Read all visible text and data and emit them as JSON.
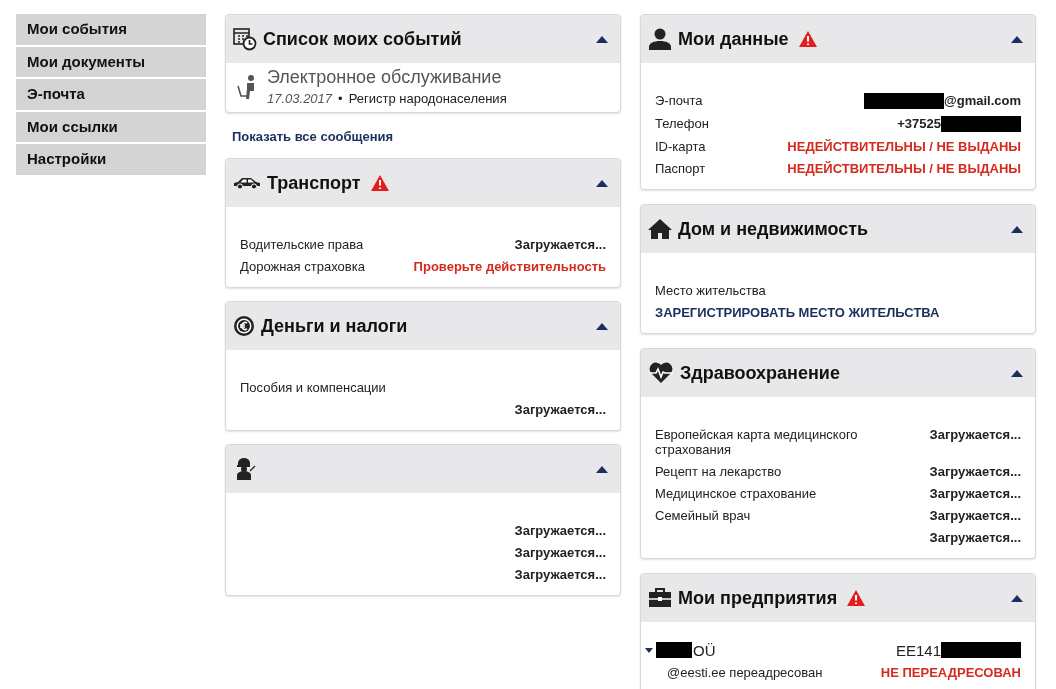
{
  "sidebar": {
    "items": [
      {
        "label": "Мои события",
        "selected": false
      },
      {
        "label": "Мои документы",
        "selected": false
      },
      {
        "label": "Э-почта",
        "selected": false
      },
      {
        "label": "Мои ссылки",
        "selected": false
      },
      {
        "label": "Настройки",
        "selected": false
      }
    ]
  },
  "columns": [
    [
      {
        "kind": "events",
        "title": "Список моих событий",
        "warning": false,
        "expanded": true,
        "events": [
          {
            "title": "Электронное обслуживание",
            "date": "17.03.2017",
            "separator": "•",
            "source": "Регистр народонаселения"
          }
        ],
        "link": "Показать все сообщения"
      },
      {
        "kind": "rows",
        "title": "Транспорт",
        "warning": true,
        "expanded": true,
        "rows": [
          {
            "label": "Водительские права",
            "value": "Загружается...",
            "alert": false
          },
          {
            "label": "Дорожная страховка",
            "value": "Проверьте действительность",
            "alert": true
          }
        ]
      },
      {
        "kind": "rows",
        "title": "Деньги и налоги",
        "warning": false,
        "expanded": true,
        "rows": [
          {
            "label": "Пособия и компенсации"
          },
          {
            "value": "Загружается...",
            "alert": false
          }
        ]
      },
      {
        "kind": "rows",
        "warning": false,
        "expanded": true,
        "rows": [
          {
            "value": "Загружается...",
            "alert": false
          },
          {
            "value": "Загружается...",
            "alert": false
          },
          {
            "value": "Загружается...",
            "alert": false
          }
        ]
      }
    ],
    [
      {
        "kind": "rows",
        "title": "Мои данные",
        "warning": true,
        "expanded": true,
        "rows": [
          {
            "label": "Э-почта",
            "value": "@gmail.com",
            "alert": false,
            "redacted_before": true
          },
          {
            "label": "Телефон",
            "value": "+37525",
            "alert": false,
            "redacted_after": true
          },
          {
            "label": "ID-карта",
            "value": "НЕДЕЙСТВИТЕЛЬНЫ / НЕ ВЫДАНЫ",
            "alert": true
          },
          {
            "label": "Паспорт",
            "value": "НЕДЕЙСТВИТЕЛЬНЫ / НЕ ВЫДАНЫ",
            "alert": true
          }
        ]
      },
      {
        "kind": "rows",
        "title": "Дом и недвижимость",
        "warning": false,
        "expanded": true,
        "rows": [
          {
            "label": "Место жительства"
          },
          {
            "kind": "link",
            "label": "ЗАРЕГИСТРИРОВАТЬ МЕСТО ЖИТЕЛЬСТВА"
          }
        ]
      },
      {
        "kind": "rows",
        "title": "Здравоохранение",
        "warning": false,
        "expanded": true,
        "rows": [
          {
            "label": "Европейская карта медицинского страхования",
            "value": "Загружается...",
            "alert": false
          },
          {
            "label": "Рецепт на лекарство",
            "value": "Загружается...",
            "alert": false
          },
          {
            "label": "Медицинское страхование",
            "value": "Загружается...",
            "alert": false
          },
          {
            "label": "Семейный врач",
            "value": "Загружается...",
            "alert": false
          },
          {
            "value": "Загружается...",
            "alert": false
          }
        ]
      },
      {
        "kind": "rows",
        "title": "Мои предприятия",
        "warning": true,
        "expanded": true,
        "rows": [
          {
            "kind": "company",
            "label": "OÜ",
            "label_redacted": true,
            "expanded": true,
            "value": "EE141",
            "alert": false,
            "redacted_after": true
          },
          {
            "label": "@eesti.ee переадресован",
            "indent": true,
            "value": "НЕ ПЕРЕАДРЕСОВАН",
            "alert": true
          }
        ]
      }
    ]
  ]
}
